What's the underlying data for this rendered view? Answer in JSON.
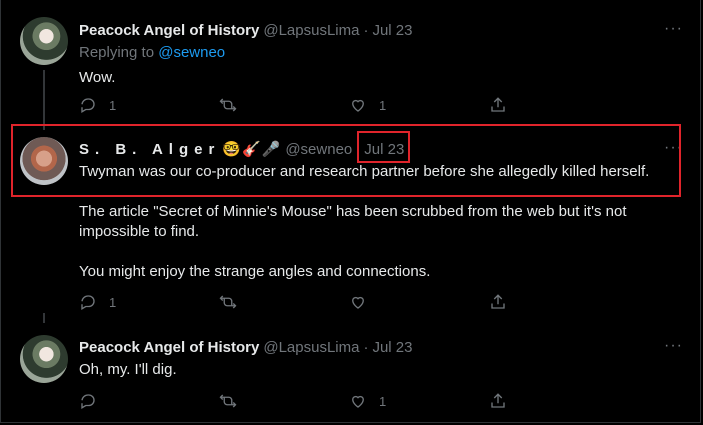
{
  "tweets": [
    {
      "name": "Peacock Angel of History",
      "handle": "@LapsusLima",
      "separator": "·",
      "date": "Jul 23",
      "reply_prefix": "Replying to",
      "reply_handle": "@sewneo",
      "text": "Wow.",
      "reply_count": "1",
      "retweet_count": "",
      "like_count": "1",
      "more": "···"
    },
    {
      "name": "S. B. Alger",
      "emojis": "🤓🎸🎤",
      "handle": "@sewneo",
      "date": "Jul 23",
      "paragraph1": "Twyman was our co-producer and research partner before she allegedly killed herself.",
      "paragraph2": "The article \"Secret of Minnie's Mouse\" has been scrubbed from the web but it's not impossible to find.",
      "paragraph3": "You might enjoy the strange angles and connections.",
      "reply_count": "1",
      "retweet_count": "",
      "like_count": "",
      "more": "···"
    },
    {
      "name": "Peacock Angel of History",
      "handle": "@LapsusLima",
      "separator": "·",
      "date": "Jul 23",
      "text": "Oh, my. I'll dig.",
      "reply_count": "",
      "retweet_count": "",
      "like_count": "1",
      "more": "···"
    }
  ],
  "colors": {
    "background": "#000000",
    "text": "#e7e9ea",
    "muted": "#71767b",
    "link": "#1d9bf0",
    "annotation": "#e0242b"
  }
}
